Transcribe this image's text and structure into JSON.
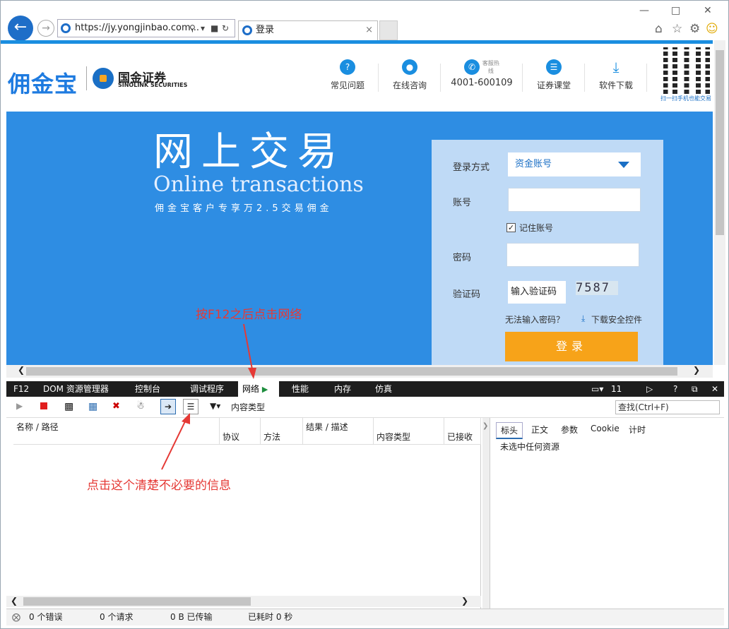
{
  "browser": {
    "url": "https://jy.yongjinbao.com...",
    "tab_title": "登录",
    "tab_close": "×"
  },
  "site": {
    "logo_text": "佣金宝",
    "partner_name": "国金证券",
    "partner_en": "SINOLINK SECURITIES",
    "nav": [
      {
        "label": "常见问题",
        "icon": "faq-bubble-icon"
      },
      {
        "label": "在线咨询",
        "icon": "chat-penguin-icon"
      },
      {
        "label": "4001-600109",
        "icon": "phone-hotline-icon",
        "sub": "客服热线"
      },
      {
        "label": "证券课堂",
        "icon": "book-icon"
      },
      {
        "label": "软件下载",
        "icon": "download-icon"
      }
    ],
    "qr_caption": "扫一扫手机也能交易"
  },
  "banner": {
    "title": "网上交易",
    "title_en": "Online transactions",
    "subtitle": "佣金宝客户专享万2.5交易佣金"
  },
  "login": {
    "method_label": "登录方式",
    "method_value": "资金账号",
    "account_label": "账号",
    "remember_label": "记住账号",
    "remember_checked": true,
    "password_label": "密码",
    "captcha_label": "验证码",
    "captcha_placeholder": "输入验证码",
    "captcha_code": "7587",
    "cant_input": "无法输入密码？",
    "download_ctrl": "下载安全控件",
    "submit": "登录"
  },
  "devtools": {
    "tabs": [
      "F12",
      "DOM 资源管理器",
      "控制台",
      "调试程序",
      "网络",
      "性能",
      "内存",
      "仿真"
    ],
    "active_tab": "网络",
    "doc_mode": "11",
    "content_type_label": "内容类型",
    "find_placeholder": "查找(Ctrl+F)",
    "columns": [
      "名称 / 路径",
      "协议",
      "方法",
      "结果 / 描述",
      "内容类型",
      "已接收"
    ],
    "right_tabs": [
      "标头",
      "正文",
      "参数",
      "Cookie",
      "计时"
    ],
    "right_empty": "未选中任何资源",
    "status": {
      "errors": "0 个错误",
      "requests": "0 个请求",
      "transferred": "0 B 已传输",
      "elapsed": "已耗时 0 秒"
    }
  },
  "annotations": {
    "top": "按F12之后点击网络",
    "bottom": "点击这个清楚不必要的信息",
    "color": "#e53935"
  }
}
